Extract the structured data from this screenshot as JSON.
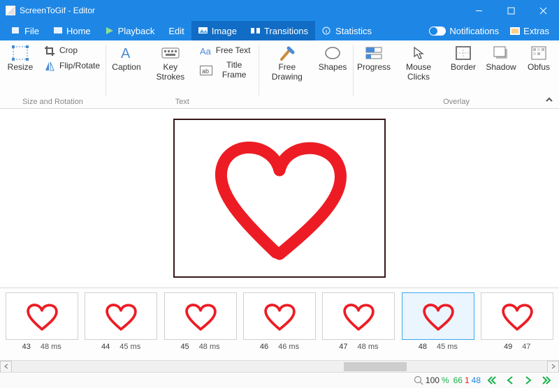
{
  "window": {
    "title": "ScreenToGif - Editor"
  },
  "menu": {
    "tabs": [
      "File",
      "Home",
      "Playback",
      "Edit",
      "Image",
      "Transitions",
      "Statistics"
    ],
    "active": 4,
    "right": {
      "notifications": "Notifications",
      "extras": "Extras"
    }
  },
  "ribbon": {
    "groups": [
      {
        "label": "Size and Rotation",
        "items": [
          {
            "id": "resize",
            "label": "Resize",
            "icon": "resize-icon",
            "layout": "big"
          },
          {
            "id": "crop",
            "label": "Crop",
            "icon": "crop-icon",
            "layout": "small"
          },
          {
            "id": "fliprotate",
            "label": "Flip/Rotate",
            "icon": "fliprotate-icon",
            "layout": "small"
          }
        ]
      },
      {
        "label": "Text",
        "items": [
          {
            "id": "caption",
            "label": "Caption",
            "icon": "caption-icon",
            "layout": "big"
          },
          {
            "id": "keystrokes",
            "label": "Key Strokes",
            "icon": "keystrokes-icon",
            "layout": "big"
          },
          {
            "id": "freetext",
            "label": "Free Text",
            "icon": "freetext-icon",
            "layout": "small"
          },
          {
            "id": "titleframe",
            "label": "Title Frame",
            "icon": "titleframe-icon",
            "layout": "small"
          }
        ]
      },
      {
        "label": "",
        "items": [
          {
            "id": "freedraw",
            "label": "Free Drawing",
            "icon": "freedraw-icon",
            "layout": "big"
          },
          {
            "id": "shapes",
            "label": "Shapes",
            "icon": "shapes-icon",
            "layout": "big"
          }
        ]
      },
      {
        "label": "Overlay",
        "items": [
          {
            "id": "progress",
            "label": "Progress",
            "icon": "progress-icon",
            "layout": "big"
          },
          {
            "id": "mouseclicks",
            "label": "Mouse Clicks",
            "icon": "mouseclicks-icon",
            "layout": "big"
          },
          {
            "id": "border",
            "label": "Border",
            "icon": "border-icon",
            "layout": "big"
          },
          {
            "id": "shadow",
            "label": "Shadow",
            "icon": "shadow-icon",
            "layout": "big"
          },
          {
            "id": "obfus",
            "label": "Obfus",
            "icon": "obfuscate-icon",
            "layout": "big"
          }
        ]
      }
    ]
  },
  "frames": [
    {
      "index": 43,
      "duration": "48 ms"
    },
    {
      "index": 44,
      "duration": "45 ms"
    },
    {
      "index": 45,
      "duration": "48 ms"
    },
    {
      "index": 46,
      "duration": "46 ms"
    },
    {
      "index": 47,
      "duration": "48 ms"
    },
    {
      "index": 48,
      "duration": "45 ms",
      "selected": true
    },
    {
      "index": 49,
      "duration": "47"
    }
  ],
  "status": {
    "zoom": "100",
    "zoom_unit": "%",
    "frame_total": "66",
    "frame_current": "1",
    "frame_selected": "48"
  }
}
